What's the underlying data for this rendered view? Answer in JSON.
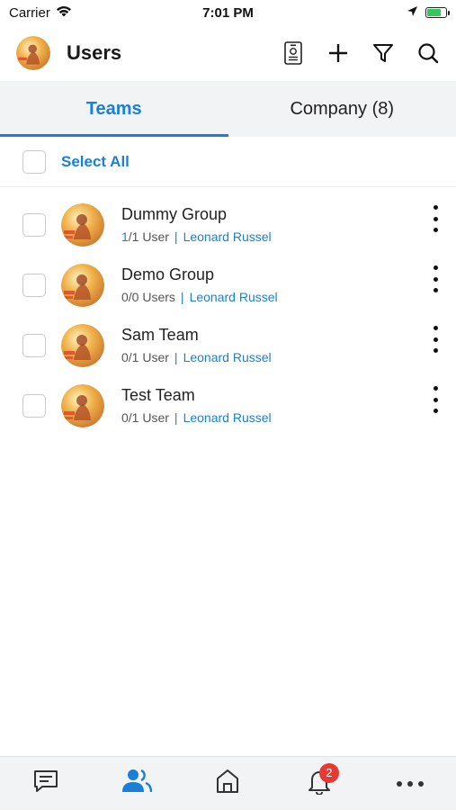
{
  "status_bar": {
    "carrier": "Carrier",
    "time": "7:01 PM"
  },
  "header": {
    "title": "Users",
    "avatar_icon": "user-avatar",
    "actions": [
      "contact-card-icon",
      "plus-icon",
      "filter-icon",
      "search-icon"
    ]
  },
  "tabs": [
    {
      "label": "Teams",
      "active": true
    },
    {
      "label": "Company (8)",
      "active": false
    }
  ],
  "select_all": {
    "label": "Select All"
  },
  "teams": [
    {
      "name": "Dummy Group",
      "users_done": "1",
      "users_rest": "/1 User",
      "separator": "|",
      "owner": "Leonard Russel"
    },
    {
      "name": "Demo Group",
      "users_done": "0",
      "users_rest": "/0 Users",
      "separator": "|",
      "owner": "Leonard Russel"
    },
    {
      "name": "Sam Team",
      "users_done": "0",
      "users_rest": "/1 User",
      "separator": "|",
      "owner": "Leonard Russel"
    },
    {
      "name": "Test Team",
      "users_done": "0",
      "users_rest": "/1 User",
      "separator": "|",
      "owner": "Leonard Russel"
    }
  ],
  "bottom_nav": {
    "items": [
      "chat-icon",
      "users-icon",
      "home-icon",
      "bell-icon",
      "more-icon"
    ],
    "active": "users-icon",
    "notification_count": "2"
  },
  "colors": {
    "accent": "#1a7fd6",
    "badge": "#e53935",
    "tab_bg": "#f2f3f5"
  }
}
